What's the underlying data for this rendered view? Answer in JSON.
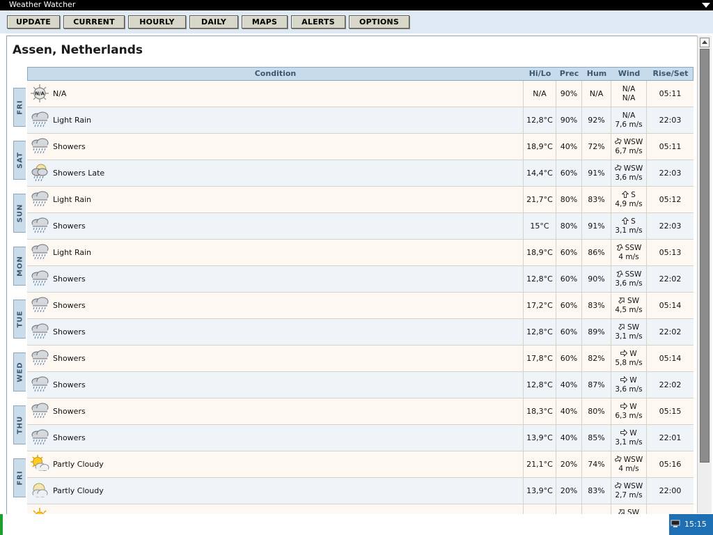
{
  "app": {
    "title": "Weather Watcher"
  },
  "toolbar": {
    "buttons": [
      {
        "label": "UPDATE"
      },
      {
        "label": "CURRENT"
      },
      {
        "label": "HOURLY"
      },
      {
        "label": "DAILY"
      },
      {
        "label": "MAPS"
      },
      {
        "label": "ALERTS"
      },
      {
        "label": "OPTIONS"
      }
    ]
  },
  "location": "Assen, Netherlands",
  "columns": {
    "condition": "Condition",
    "hilo": "Hi/Lo",
    "prec": "Prec",
    "hum": "Hum",
    "wind": "Wind",
    "riseset": "Rise/Set"
  },
  "days": [
    {
      "label": "FRI",
      "rows": [
        {
          "icon": "na-sun",
          "condition": "N/A",
          "hilo": "N/A",
          "prec": "90%",
          "hum": "N/A",
          "wind_dir": "N/A",
          "wind_speed": "N/A",
          "riseset": "05:11",
          "wind_arrow": ""
        },
        {
          "icon": "rain-cloud",
          "condition": "Light Rain",
          "hilo": "12,8°C",
          "prec": "90%",
          "hum": "92%",
          "wind_dir": "N/A",
          "wind_speed": "7,6 m/s",
          "riseset": "22:03",
          "wind_arrow": ""
        }
      ]
    },
    {
      "label": "SAT",
      "rows": [
        {
          "icon": "rain-cloud",
          "condition": "Showers",
          "hilo": "18,9°C",
          "prec": "40%",
          "hum": "72%",
          "wind_dir": "WSW",
          "wind_speed": "6,7 m/s",
          "riseset": "05:11",
          "wind_arrow": "arrow-wsw"
        },
        {
          "icon": "moon-rain-cloud",
          "condition": "Showers Late",
          "hilo": "14,4°C",
          "prec": "60%",
          "hum": "91%",
          "wind_dir": "WSW",
          "wind_speed": "3,6 m/s",
          "riseset": "22:03",
          "wind_arrow": "arrow-wsw"
        }
      ]
    },
    {
      "label": "SUN",
      "rows": [
        {
          "icon": "rain-cloud",
          "condition": "Light Rain",
          "hilo": "21,7°C",
          "prec": "80%",
          "hum": "83%",
          "wind_dir": "S",
          "wind_speed": "4,9 m/s",
          "riseset": "05:12",
          "wind_arrow": "arrow-s"
        },
        {
          "icon": "rain-cloud",
          "condition": "Showers",
          "hilo": "15°C",
          "prec": "80%",
          "hum": "91%",
          "wind_dir": "S",
          "wind_speed": "3,1 m/s",
          "riseset": "22:03",
          "wind_arrow": "arrow-s"
        }
      ]
    },
    {
      "label": "MON",
      "rows": [
        {
          "icon": "rain-cloud",
          "condition": "Light Rain",
          "hilo": "18,9°C",
          "prec": "60%",
          "hum": "86%",
          "wind_dir": "SSW",
          "wind_speed": "4 m/s",
          "riseset": "05:13",
          "wind_arrow": "arrow-ssw"
        },
        {
          "icon": "rain-cloud",
          "condition": "Showers",
          "hilo": "12,8°C",
          "prec": "60%",
          "hum": "90%",
          "wind_dir": "SSW",
          "wind_speed": "3,6 m/s",
          "riseset": "22:02",
          "wind_arrow": "arrow-ssw"
        }
      ]
    },
    {
      "label": "TUE",
      "rows": [
        {
          "icon": "rain-cloud",
          "condition": "Showers",
          "hilo": "17,2°C",
          "prec": "60%",
          "hum": "83%",
          "wind_dir": "SW",
          "wind_speed": "4,5 m/s",
          "riseset": "05:14",
          "wind_arrow": "arrow-sw"
        },
        {
          "icon": "rain-cloud",
          "condition": "Showers",
          "hilo": "12,8°C",
          "prec": "60%",
          "hum": "89%",
          "wind_dir": "SW",
          "wind_speed": "3,1 m/s",
          "riseset": "22:02",
          "wind_arrow": "arrow-sw"
        }
      ]
    },
    {
      "label": "WED",
      "rows": [
        {
          "icon": "rain-cloud",
          "condition": "Showers",
          "hilo": "17,8°C",
          "prec": "60%",
          "hum": "82%",
          "wind_dir": "W",
          "wind_speed": "5,8 m/s",
          "riseset": "05:14",
          "wind_arrow": "arrow-w"
        },
        {
          "icon": "rain-cloud",
          "condition": "Showers",
          "hilo": "12,8°C",
          "prec": "40%",
          "hum": "87%",
          "wind_dir": "W",
          "wind_speed": "3,6 m/s",
          "riseset": "22:02",
          "wind_arrow": "arrow-w"
        }
      ]
    },
    {
      "label": "THU",
      "rows": [
        {
          "icon": "rain-cloud",
          "condition": "Showers",
          "hilo": "18,3°C",
          "prec": "40%",
          "hum": "80%",
          "wind_dir": "W",
          "wind_speed": "6,3 m/s",
          "riseset": "05:15",
          "wind_arrow": "arrow-w"
        },
        {
          "icon": "rain-cloud",
          "condition": "Showers",
          "hilo": "13,9°C",
          "prec": "40%",
          "hum": "85%",
          "wind_dir": "W",
          "wind_speed": "3,1 m/s",
          "riseset": "22:01",
          "wind_arrow": "arrow-w"
        }
      ]
    },
    {
      "label": "FRI",
      "rows": [
        {
          "icon": "partly-cloudy-sun",
          "condition": "Partly Cloudy",
          "hilo": "21,1°C",
          "prec": "20%",
          "hum": "74%",
          "wind_dir": "WSW",
          "wind_speed": "4 m/s",
          "riseset": "05:16",
          "wind_arrow": "arrow-wsw"
        },
        {
          "icon": "partly-cloudy-moon",
          "condition": "Partly Cloudy",
          "hilo": "13,9°C",
          "prec": "20%",
          "hum": "83%",
          "wind_dir": "WSW",
          "wind_speed": "2,7 m/s",
          "riseset": "22:00",
          "wind_arrow": "arrow-wsw"
        }
      ]
    },
    {
      "label": "",
      "rows": [
        {
          "icon": "sun",
          "condition": "",
          "hilo": "",
          "prec": "",
          "hum": "",
          "wind_dir": "SW",
          "wind_speed": "",
          "riseset": "",
          "wind_arrow": "arrow-sw"
        }
      ]
    }
  ],
  "taskbar": {
    "clock": "15:15"
  }
}
